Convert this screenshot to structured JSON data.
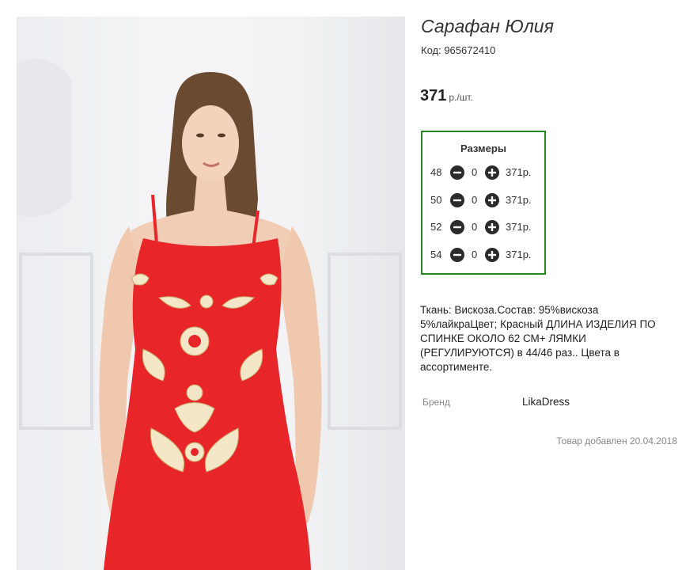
{
  "product": {
    "title": "Сарафан Юлия",
    "code": "Код: 965672410",
    "image_alt": "red embroidered sundress"
  },
  "price": {
    "amount": "371",
    "unit": "р./шт."
  },
  "sizes": {
    "title": "Размеры",
    "rows": [
      {
        "size": "48",
        "qty": "0",
        "price": "371р."
      },
      {
        "size": "50",
        "qty": "0",
        "price": "371р."
      },
      {
        "size": "52",
        "qty": "0",
        "price": "371р."
      },
      {
        "size": "54",
        "qty": "0",
        "price": "371р."
      }
    ]
  },
  "description": "Ткань: Вискоза.Состав: 95%вискоза 5%лайкраЦвет; Красный ДЛИНА ИЗДЕЛИЯ ПО СПИНКЕ ОКОЛО 62 СМ+ ЛЯМКИ (РЕГУЛИРУЮТСЯ) в 44/46 раз.. Цвета в ассортименте.",
  "brand": {
    "label": "Бренд",
    "value": "LikaDress"
  },
  "added": "Товар добавлен 20.04.2018",
  "colors": {
    "border_accent": "#228b22",
    "dress": "#e8262a",
    "cta": "#a6dc2e"
  },
  "icons": {
    "minus": "minus-circle-icon",
    "plus": "plus-circle-icon"
  }
}
